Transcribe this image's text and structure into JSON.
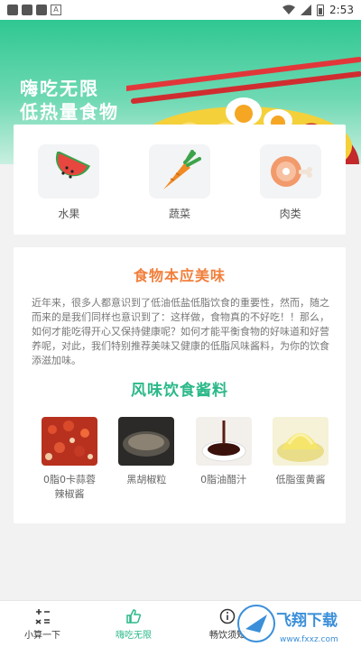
{
  "status_bar": {
    "time": "2:53",
    "a_icon": "A"
  },
  "hero": {
    "title_line1": "嗨吃无限",
    "title_line2": "低热量食物"
  },
  "categories": [
    {
      "label": "水果",
      "icon": "watermelon-icon"
    },
    {
      "label": "蔬菜",
      "icon": "carrot-icon"
    },
    {
      "label": "肉类",
      "icon": "meat-icon"
    }
  ],
  "article": {
    "title": "食物本应美味",
    "body": "近年来，很多人都意识到了低油低盐低脂饮食的重要性，然而，随之而来的是我们同样也意识到了：这样做，食物真的不好吃！！那么，如何才能吃得开心又保持健康呢？如何才能平衡食物的好味道和好营养呢，对此，我们特别推荐美味又健康的低脂风味酱料，为你的饮食添滋加味。",
    "sauce_title": "风味饮食酱料",
    "sauces": [
      {
        "label": "0脂0卡蒜蓉辣椒酱"
      },
      {
        "label": "黑胡椒粒"
      },
      {
        "label": "0脂油醋汁"
      },
      {
        "label": "低脂蛋黄酱"
      }
    ]
  },
  "bottom_nav": {
    "items": [
      {
        "label": "小算一下"
      },
      {
        "label": "嗨吃无限"
      },
      {
        "label": "畅饮须知"
      }
    ]
  },
  "watermark": {
    "text": "飞翔下载",
    "url_text": "www.fxxz.com"
  },
  "colors": {
    "primary_green": "#2bb988",
    "accent_orange": "#f17f3b"
  }
}
